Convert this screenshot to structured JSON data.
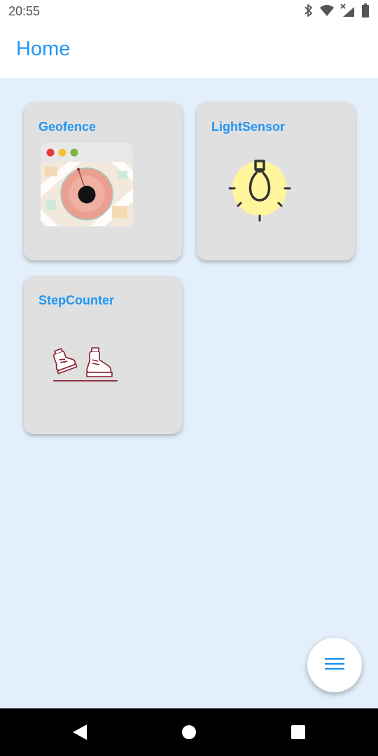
{
  "status_bar": {
    "time": "20:55",
    "icons": [
      "bluetooth-icon",
      "wifi-icon",
      "cellular-no-data-icon",
      "battery-icon"
    ]
  },
  "app_bar": {
    "title": "Home"
  },
  "cards": [
    {
      "title": "Geofence",
      "icon": "geofence-map-icon"
    },
    {
      "title": "LightSensor",
      "icon": "light-bulb-icon"
    },
    {
      "title": "StepCounter",
      "icon": "sneakers-icon"
    }
  ],
  "fab": {
    "icon": "menu-icon"
  },
  "nav_bar": {
    "buttons": [
      "back-icon",
      "home-icon",
      "recents-icon"
    ]
  },
  "colors": {
    "accent": "#2196f3",
    "content_background": "#e3f0fb",
    "card_background": "#e0e0e0"
  }
}
